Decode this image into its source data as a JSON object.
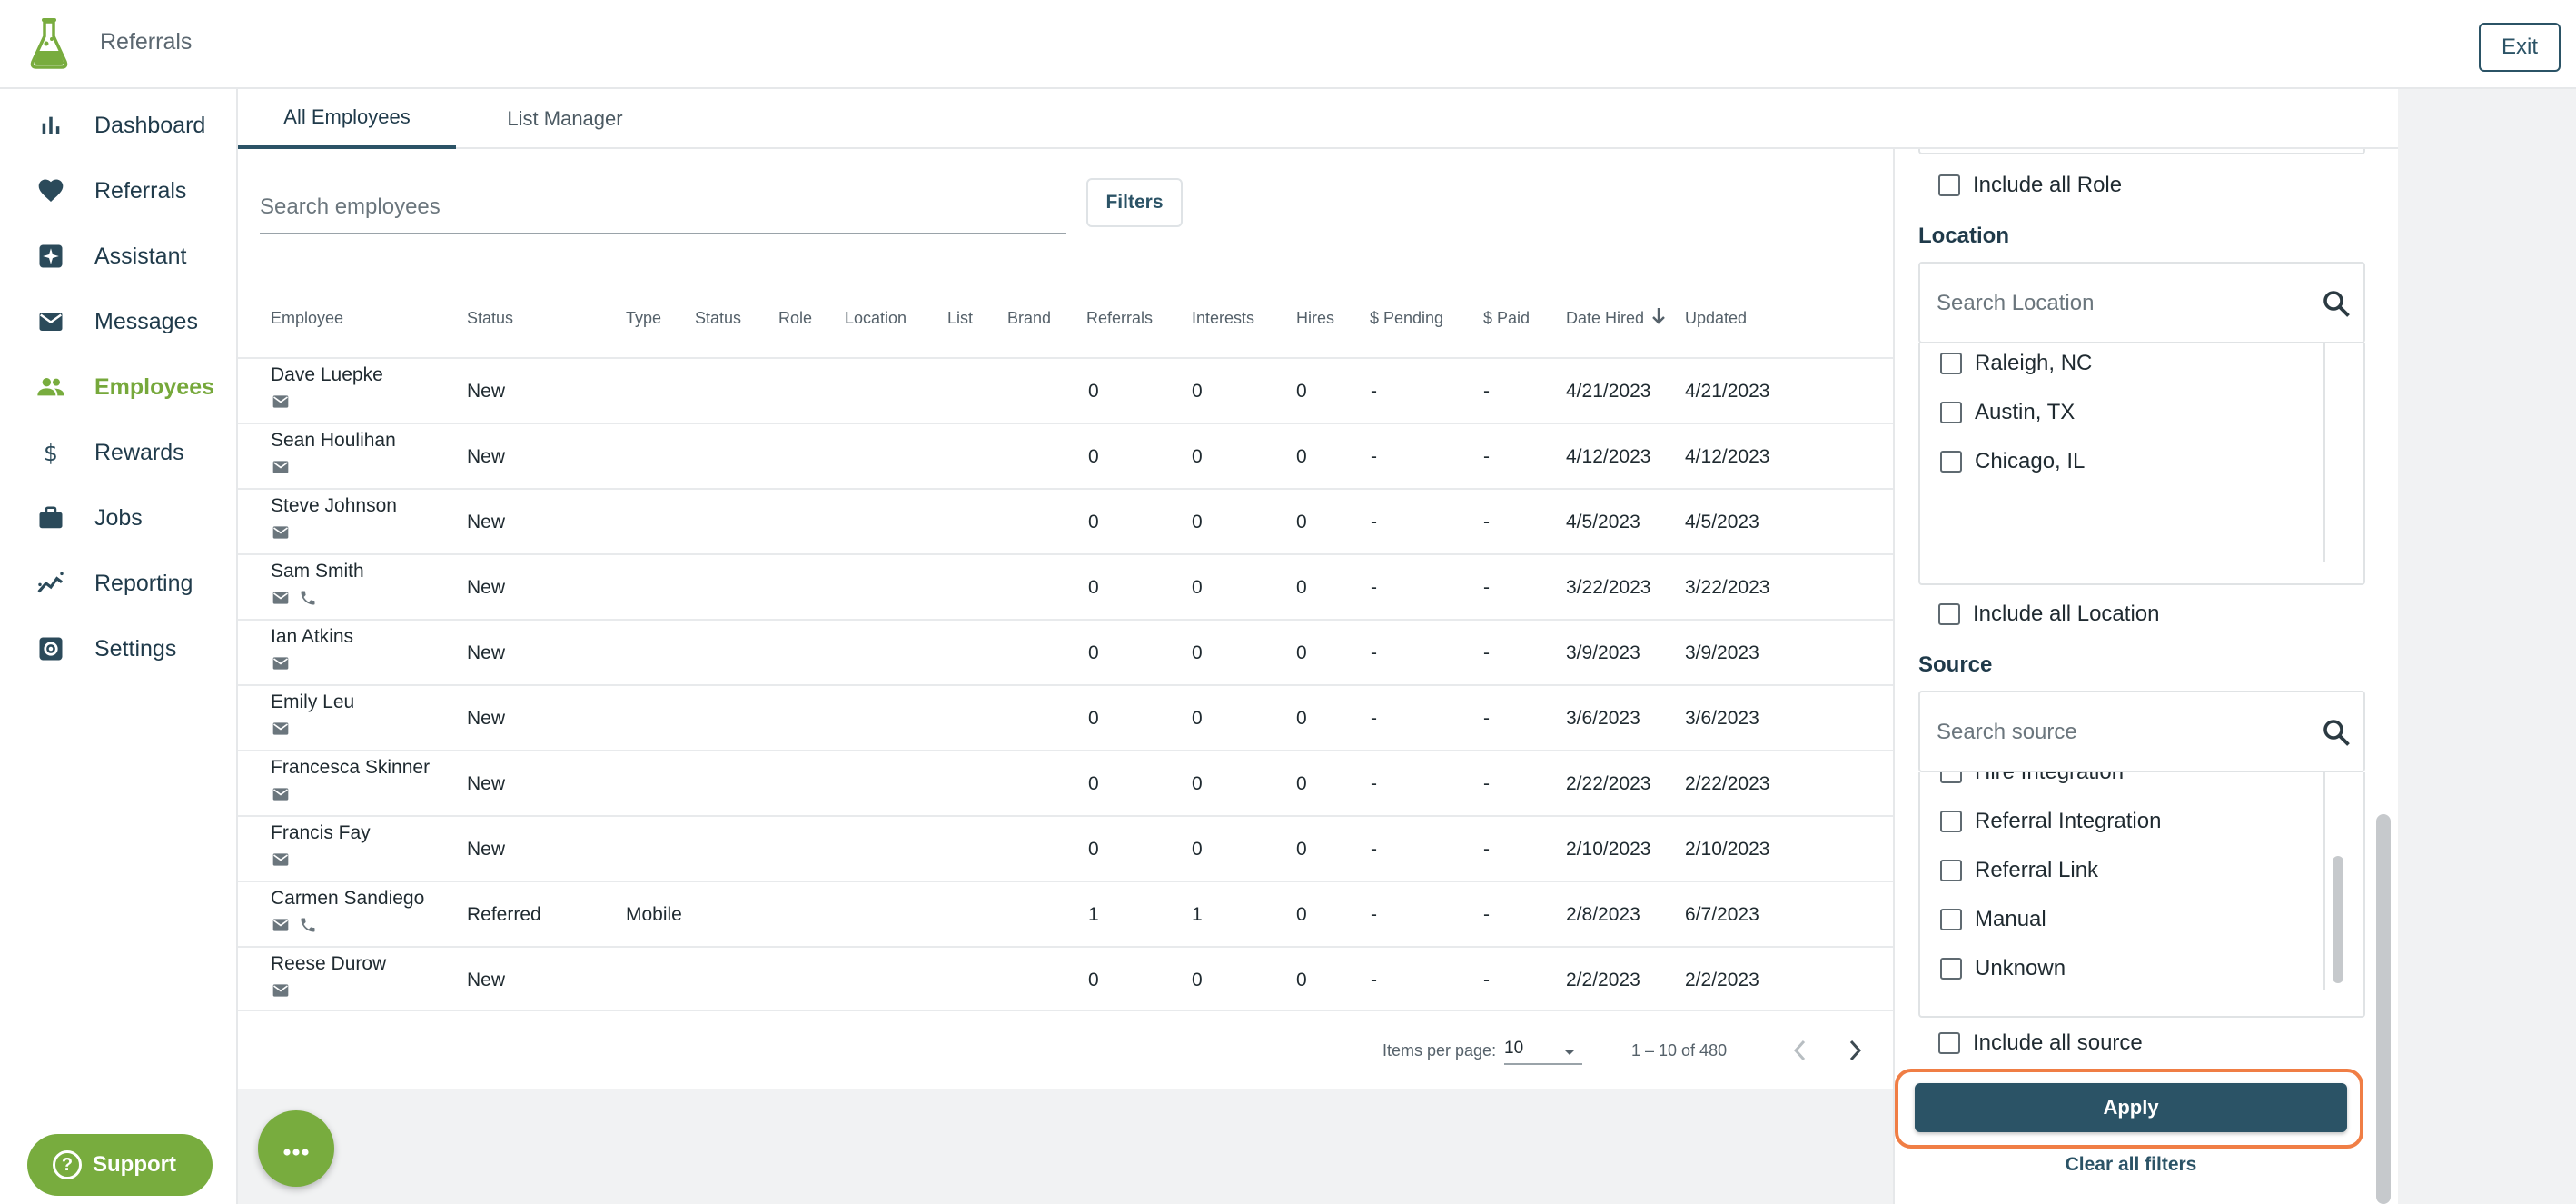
{
  "header": {
    "app_title": "Referrals",
    "exit_label": "Exit"
  },
  "sidebar": {
    "items": [
      {
        "label": "Dashboard",
        "icon": "bar-chart-icon"
      },
      {
        "label": "Referrals",
        "icon": "heart-icon"
      },
      {
        "label": "Assistant",
        "icon": "sparkle-icon"
      },
      {
        "label": "Messages",
        "icon": "mail-icon"
      },
      {
        "label": "Employees",
        "icon": "people-icon",
        "active": true
      },
      {
        "label": "Rewards",
        "icon": "dollar-icon"
      },
      {
        "label": "Jobs",
        "icon": "briefcase-icon"
      },
      {
        "label": "Reporting",
        "icon": "trend-icon"
      },
      {
        "label": "Settings",
        "icon": "gear-icon"
      }
    ],
    "support_label": "Support"
  },
  "tabs": [
    {
      "label": "All Employees",
      "active": true
    },
    {
      "label": "List Manager"
    }
  ],
  "search": {
    "placeholder": "Search employees"
  },
  "filters_label": "Filters",
  "table": {
    "columns": [
      "Employee",
      "Status",
      "Type",
      "Status",
      "Role",
      "Location",
      "List",
      "Brand",
      "Referrals",
      "Interests",
      "Hires",
      "$ Pending",
      "$ Paid",
      "Date Hired",
      "Updated"
    ],
    "rows": [
      {
        "name": "Dave Luepke",
        "status": "New",
        "type": "",
        "referrals": "0",
        "interests": "0",
        "hires": "0",
        "pending": "-",
        "paid": "-",
        "date_hired": "4/21/2023",
        "updated": "4/21/2023",
        "phone": false
      },
      {
        "name": "Sean Houlihan",
        "status": "New",
        "type": "",
        "referrals": "0",
        "interests": "0",
        "hires": "0",
        "pending": "-",
        "paid": "-",
        "date_hired": "4/12/2023",
        "updated": "4/12/2023",
        "phone": false
      },
      {
        "name": "Steve Johnson",
        "status": "New",
        "type": "",
        "referrals": "0",
        "interests": "0",
        "hires": "0",
        "pending": "-",
        "paid": "-",
        "date_hired": "4/5/2023",
        "updated": "4/5/2023",
        "phone": false
      },
      {
        "name": "Sam Smith",
        "status": "New",
        "type": "",
        "referrals": "0",
        "interests": "0",
        "hires": "0",
        "pending": "-",
        "paid": "-",
        "date_hired": "3/22/2023",
        "updated": "3/22/2023",
        "phone": true
      },
      {
        "name": "Ian Atkins",
        "status": "New",
        "type": "",
        "referrals": "0",
        "interests": "0",
        "hires": "0",
        "pending": "-",
        "paid": "-",
        "date_hired": "3/9/2023",
        "updated": "3/9/2023",
        "phone": false
      },
      {
        "name": "Emily Leu",
        "status": "New",
        "type": "",
        "referrals": "0",
        "interests": "0",
        "hires": "0",
        "pending": "-",
        "paid": "-",
        "date_hired": "3/6/2023",
        "updated": "3/6/2023",
        "phone": false
      },
      {
        "name": "Francesca Skinner",
        "status": "New",
        "type": "",
        "referrals": "0",
        "interests": "0",
        "hires": "0",
        "pending": "-",
        "paid": "-",
        "date_hired": "2/22/2023",
        "updated": "2/22/2023",
        "phone": false
      },
      {
        "name": "Francis Fay",
        "status": "New",
        "type": "",
        "referrals": "0",
        "interests": "0",
        "hires": "0",
        "pending": "-",
        "paid": "-",
        "date_hired": "2/10/2023",
        "updated": "2/10/2023",
        "phone": false
      },
      {
        "name": "Carmen Sandiego",
        "status": "Referred",
        "type": "Mobile",
        "referrals": "1",
        "interests": "1",
        "hires": "0",
        "pending": "-",
        "paid": "-",
        "date_hired": "2/8/2023",
        "updated": "6/7/2023",
        "phone": true
      },
      {
        "name": "Reese Durow",
        "status": "New",
        "type": "",
        "referrals": "0",
        "interests": "0",
        "hires": "0",
        "pending": "-",
        "paid": "-",
        "date_hired": "2/2/2023",
        "updated": "2/2/2023",
        "phone": false
      }
    ]
  },
  "pagination": {
    "items_per_page_label": "Items per page:",
    "items_per_page": "10",
    "range": "1 – 10 of 480"
  },
  "filter_panel": {
    "include_all_role": "Include all Role",
    "location": {
      "title": "Location",
      "placeholder": "Search Location",
      "options": [
        "Raleigh, NC",
        "Austin, TX",
        "Chicago, IL"
      ],
      "include_all": "Include all Location"
    },
    "source": {
      "title": "Source",
      "placeholder": "Search source",
      "options": [
        "Hire Integration",
        "Referral Integration",
        "Referral Link",
        "Manual",
        "Unknown"
      ],
      "include_all": "Include all source"
    },
    "apply_label": "Apply",
    "clear_label": "Clear all filters"
  },
  "colors": {
    "primary": "#2b5366",
    "accent": "#78ac3e",
    "highlight": "#f07e45"
  }
}
